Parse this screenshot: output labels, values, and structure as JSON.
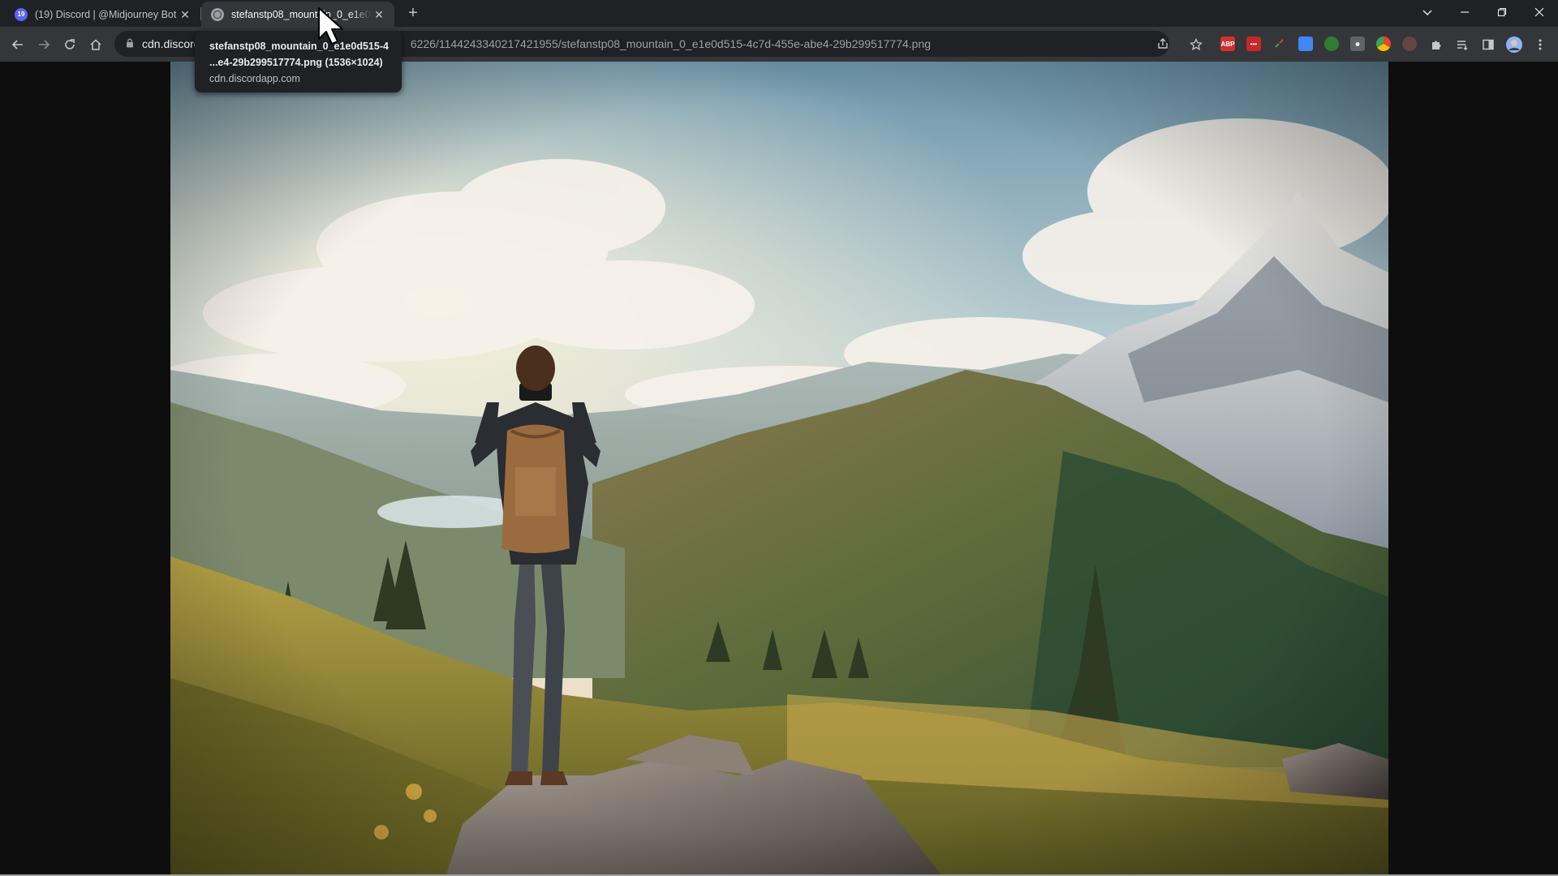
{
  "tabs": [
    {
      "title": "(19) Discord | @Midjourney Bot",
      "favicon": "discord-icon",
      "active": false
    },
    {
      "title": "stefanstp08_mountain_0_e1e0d515-4c7d-455e-abe4-29b299517774.png",
      "favicon": "globe-icon",
      "active": true
    }
  ],
  "toolbar": {
    "url_host": "cdn.discordapp.com",
    "url_path": "/attachments/1108557445813606226/1144243340217421955/stefanstp08_mountain_0_e1e0d515-4c7d-455e-abe4-29b299517774.png",
    "url_visible_head": "cdn.discorc",
    "url_visible_tail": "6226/1144243340217421955/stefanstp08_mountain_0_e1e0d515-4c7d-455e-abe4-29b299517774.png"
  },
  "extensions": [
    {
      "name": "adblock-plus-icon",
      "label": "ABP",
      "color": "#d32f2f"
    },
    {
      "name": "lastpass-icon",
      "label": "•••",
      "color": "#c62828"
    },
    {
      "name": "color-picker-icon",
      "label": "",
      "color": "#43a047"
    },
    {
      "name": "translate-icon",
      "label": "",
      "color": "#4285f4"
    },
    {
      "name": "grammar-icon",
      "label": "",
      "color": "#2e7d32"
    },
    {
      "name": "camera-icon",
      "label": "",
      "color": "#9aa0a6"
    },
    {
      "name": "chrome-ext-icon",
      "label": "",
      "color": "#fbbc04"
    },
    {
      "name": "earth-icon",
      "label": "",
      "color": "#8d6e63"
    }
  ],
  "tooltip": {
    "line1": "stefanstp08_mountain_0_e1e0d515-4",
    "line2": "...e4-29b299517774.png (1536×1024)",
    "line3": "cdn.discordapp.com"
  },
  "colors": {
    "tab_bar": "#202124",
    "toolbar": "#35363a",
    "page_bg": "#0e0e0e"
  }
}
